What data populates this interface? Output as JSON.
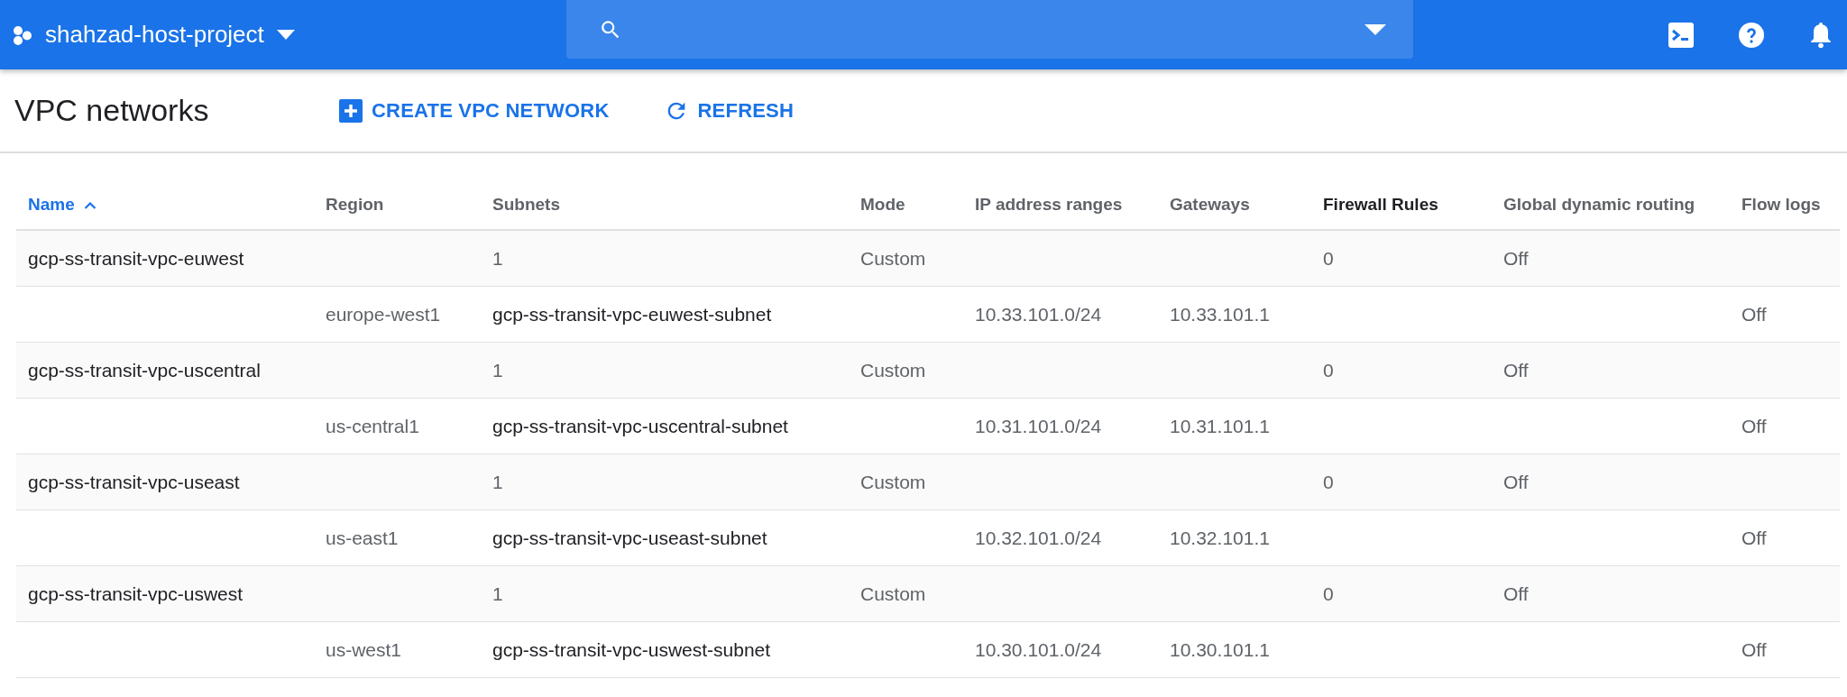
{
  "topbar": {
    "project": "shahzad-host-project"
  },
  "page": {
    "title": "VPC networks",
    "actions": [
      {
        "kind": "create",
        "label": "CREATE VPC NETWORK"
      },
      {
        "kind": "refresh",
        "label": "REFRESH"
      }
    ]
  },
  "table": {
    "columns": [
      {
        "label": "Name",
        "sorted": true,
        "hovered": false
      },
      {
        "label": "Region",
        "sorted": false,
        "hovered": false
      },
      {
        "label": "Subnets",
        "sorted": false,
        "hovered": false
      },
      {
        "label": "Mode",
        "sorted": false,
        "hovered": false
      },
      {
        "label": "IP address ranges",
        "sorted": false,
        "hovered": false
      },
      {
        "label": "Gateways",
        "sorted": false,
        "hovered": false
      },
      {
        "label": "Firewall Rules",
        "sorted": false,
        "hovered": true
      },
      {
        "label": "Global dynamic routing",
        "sorted": false,
        "hovered": false
      },
      {
        "label": "Flow logs",
        "sorted": false,
        "hovered": false
      }
    ],
    "rows": [
      {
        "kind": "network",
        "name": "gcp-ss-transit-vpc-euwest",
        "subnets": "1",
        "mode": "Custom",
        "firewall_rules": "0",
        "global_dynamic_routing": "Off"
      },
      {
        "kind": "subnet",
        "region": "europe-west1",
        "name": "gcp-ss-transit-vpc-euwest-subnet",
        "ip_range": "10.33.101.0/24",
        "gateway": "10.33.101.1",
        "flow_logs": "Off"
      },
      {
        "kind": "network",
        "name": "gcp-ss-transit-vpc-uscentral",
        "subnets": "1",
        "mode": "Custom",
        "firewall_rules": "0",
        "global_dynamic_routing": "Off"
      },
      {
        "kind": "subnet",
        "region": "us-central1",
        "name": "gcp-ss-transit-vpc-uscentral-subnet",
        "ip_range": "10.31.101.0/24",
        "gateway": "10.31.101.1",
        "flow_logs": "Off"
      },
      {
        "kind": "network",
        "name": "gcp-ss-transit-vpc-useast",
        "subnets": "1",
        "mode": "Custom",
        "firewall_rules": "0",
        "global_dynamic_routing": "Off"
      },
      {
        "kind": "subnet",
        "region": "us-east1",
        "name": "gcp-ss-transit-vpc-useast-subnet",
        "ip_range": "10.32.101.0/24",
        "gateway": "10.32.101.1",
        "flow_logs": "Off"
      },
      {
        "kind": "network",
        "name": "gcp-ss-transit-vpc-uswest",
        "subnets": "1",
        "mode": "Custom",
        "firewall_rules": "0",
        "global_dynamic_routing": "Off"
      },
      {
        "kind": "subnet",
        "region": "us-west1",
        "name": "gcp-ss-transit-vpc-uswest-subnet",
        "ip_range": "10.30.101.0/24",
        "gateway": "10.30.101.1",
        "flow_logs": "Off"
      }
    ]
  }
}
